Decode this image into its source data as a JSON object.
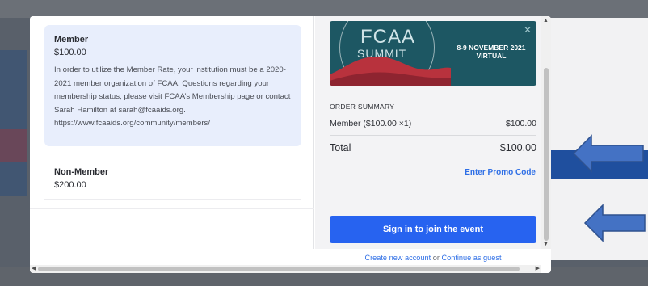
{
  "tickets": [
    {
      "name": "Member",
      "price": "$100.00",
      "description": "In order to utilize the Member Rate, your institution must be a 2020-2021 member organization of FCAA. Questions regarding your membership status, please visit FCAA’s Membership page or contact Sarah Hamilton at sarah@fcaaids.org. https://www.fcaaids.org/community/members/",
      "selected": true
    },
    {
      "name": "Non-Member",
      "price": "$200.00",
      "selected": false
    }
  ],
  "banner": {
    "title_line1": "FCAA",
    "title_line2": "SUMMIT",
    "date_line1": "8-9 NOVEMBER 2021",
    "date_line2": "VIRTUAL",
    "close_glyph": "✕"
  },
  "order_summary": {
    "title": "ORDER SUMMARY",
    "line_item_label": "Member ($100.00 ×1)",
    "line_item_amount": "$100.00",
    "total_label": "Total",
    "total_amount": "$100.00",
    "promo_label": "Enter Promo Code"
  },
  "actions": {
    "signin_label": "Sign in to join the event",
    "create_account_label": "Create new account",
    "or_label": "or",
    "guest_label": "Continue as guest"
  },
  "scrollbars": {
    "up": "▲",
    "down": "▼",
    "left": "◀",
    "right": "▶"
  },
  "colors": {
    "accent": "#2763f0",
    "selected_bg": "#e8eefc",
    "arrow_fill": "#4472c4",
    "banner_bg": "#1d5763"
  },
  "icons": {
    "banner_close": "close-icon",
    "annotation_arrow": "left-arrow-icon"
  }
}
